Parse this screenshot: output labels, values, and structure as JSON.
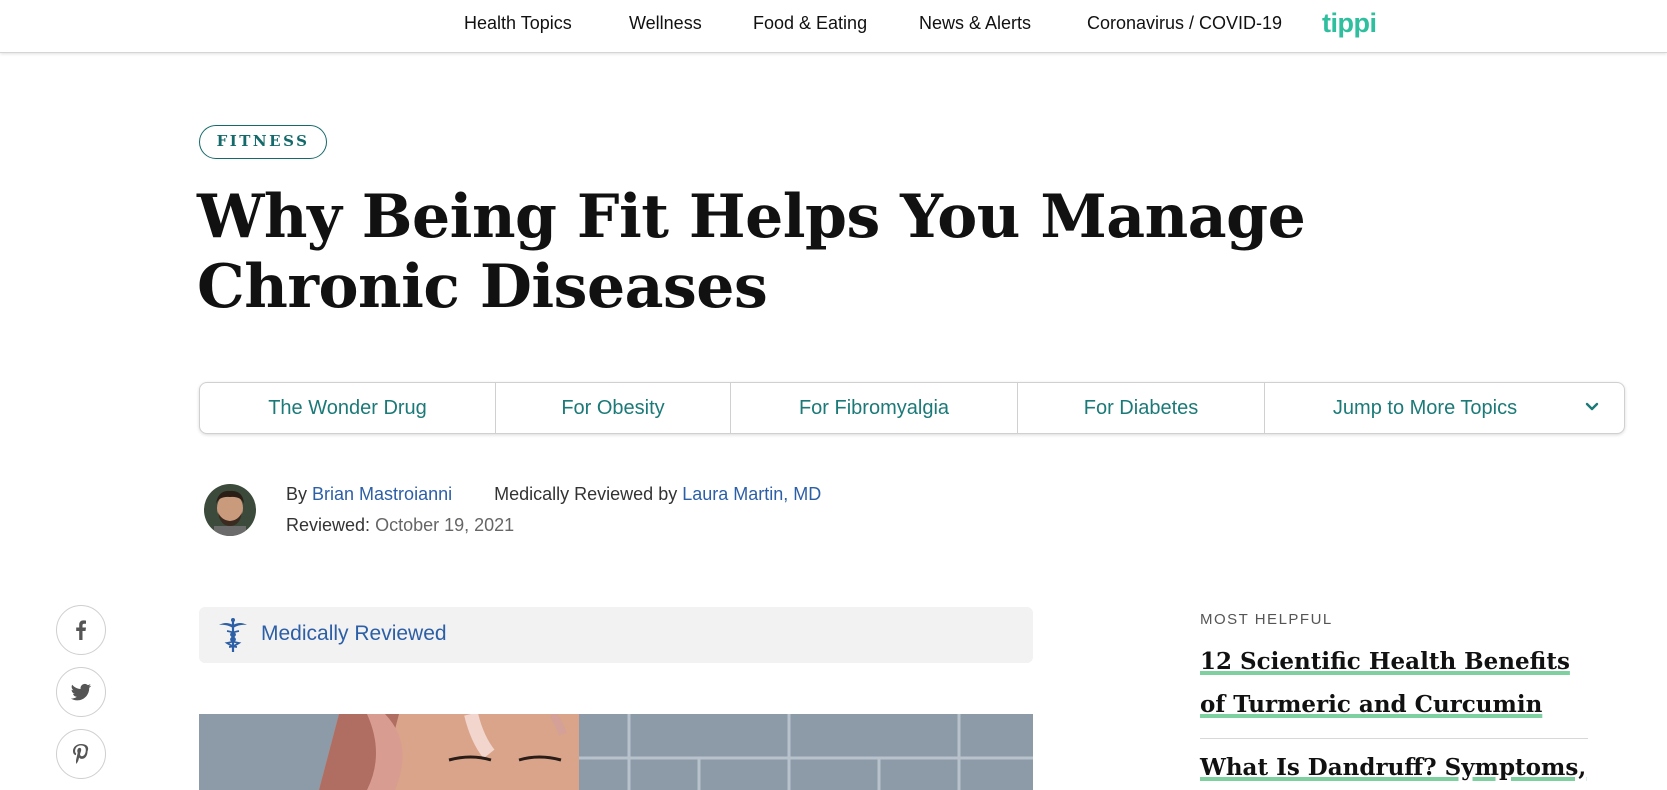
{
  "nav": {
    "items": [
      "Health Topics",
      "Wellness",
      "Food & Eating",
      "News & Alerts",
      "Coronavirus / COVID-19"
    ],
    "logo": "tippi"
  },
  "article": {
    "category": "FITNESS",
    "title": "Why Being Fit Helps You Manage Chronic Diseases",
    "toc": [
      "The Wonder Drug",
      "For Obesity",
      "For Fibromyalgia",
      "For Diabetes",
      "Jump to More Topics"
    ],
    "byline": {
      "by_prefix": "By",
      "author": "Brian Mastroianni",
      "reviewed_prefix": "Medically Reviewed by",
      "reviewer": "Laura Martin, MD",
      "reviewed_label": "Reviewed:",
      "reviewed_date": "October 19, 2021"
    },
    "medically_reviewed_label": "Medically Reviewed"
  },
  "social": [
    "facebook-icon",
    "twitter-icon",
    "pinterest-icon"
  ],
  "sidebar": {
    "label": "MOST HELPFUL",
    "links": [
      "12 Scientific Health Benefits of Turmeric and Curcumin",
      "What Is Dandruff? Symptoms,"
    ]
  },
  "colors": {
    "accent": "#1b7a78",
    "link": "#2d5fa6",
    "logo": "#2fbf9f",
    "underline": "#7fd0a1"
  }
}
